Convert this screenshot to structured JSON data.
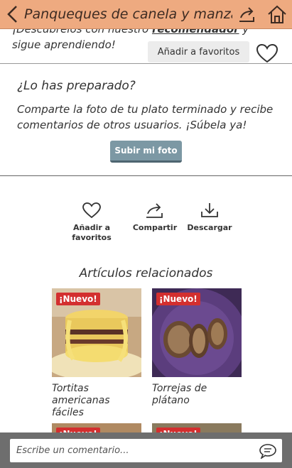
{
  "header": {
    "title": "Panqueques de canela y manza"
  },
  "intro": {
    "text_before": "¡Descúbrelos con nuestro ",
    "text_link": "recomendador",
    "text_after": " y sigue aprendiendo!",
    "favorite_label": "Añadir a favoritos"
  },
  "prepared": {
    "title": "¿Lo has preparado?",
    "description": "Comparte la foto de tu plato terminado y recibe comentarios de otros usuarios. ¡Súbela ya!",
    "button_label": "Subir mi foto"
  },
  "actions": {
    "favorites_line1": "Añadir a",
    "favorites_line2": "favoritos",
    "share": "Compartir",
    "download": "Descargar"
  },
  "related": {
    "title": "Artículos relacionados",
    "items": [
      {
        "badge": "¡Nuevo!",
        "name": "Tortitas americanas fáciles"
      },
      {
        "badge": "¡Nuevo!",
        "name": "Torrejas de plátano"
      },
      {
        "badge": "¡Nuevo!",
        "name": ""
      },
      {
        "badge": "¡Nuevo!",
        "name": ""
      }
    ]
  },
  "comment": {
    "placeholder": "Escribe un comentario..."
  },
  "colors": {
    "topbar": "#eeaa80",
    "badge": "#d32f2f",
    "upload_button": "#7c98a4",
    "comment_bar": "#6e6e6e"
  },
  "icons": [
    "chevron-left-icon",
    "share-icon",
    "home-icon",
    "heart-icon",
    "download-icon",
    "chat-bubble-icon"
  ]
}
